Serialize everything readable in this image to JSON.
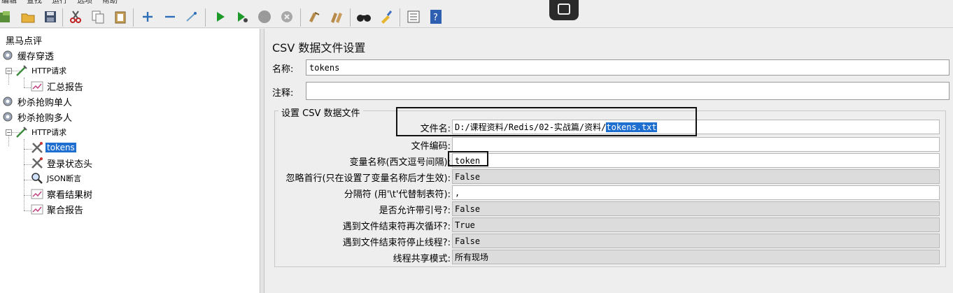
{
  "menu": [
    "编辑",
    "查找",
    "运行",
    "选项",
    "帮助"
  ],
  "toolbar_icons": [
    "new-icon",
    "open-icon",
    "save-icon",
    "cut-icon",
    "copy-icon",
    "paste-icon",
    "add-icon",
    "remove-icon",
    "toggle-icon",
    "start-icon",
    "start-no-pause-icon",
    "stop-icon",
    "shutdown-icon",
    "clear-icon",
    "clear-all-icon",
    "search-icon",
    "reset-icon",
    "function-helper-icon",
    "help-icon"
  ],
  "tree": {
    "root": "黑马点评",
    "items": [
      {
        "label": "缓存穿透",
        "icon": "gear-icon"
      },
      {
        "label": "HTTP请求",
        "icon": "pipette-icon"
      },
      {
        "label": "汇总报告",
        "icon": "chart-icon"
      },
      {
        "label": "秒杀抢购单人",
        "icon": "gear-icon"
      },
      {
        "label": "秒杀抢购多人",
        "icon": "gear-icon"
      },
      {
        "label": "HTTP请求",
        "icon": "pipette-icon"
      },
      {
        "label": "tokens",
        "icon": "wrench-icon"
      },
      {
        "label": "登录状态头",
        "icon": "wrench-icon"
      },
      {
        "label": "JSON断言",
        "icon": "magnifier-icon"
      },
      {
        "label": "察看结果树",
        "icon": "chart-icon"
      },
      {
        "label": "聚合报告",
        "icon": "chart-icon"
      }
    ]
  },
  "panel": {
    "title": "CSV 数据文件设置",
    "name_label": "名称:",
    "name_value": "tokens",
    "comment_label": "注释:",
    "comment_value": "",
    "group_title": "设置 CSV 数据文件",
    "rows": [
      {
        "label": "文件名:",
        "value_prefix": "D:/课程资料/Redis/02-实战篇/资料/",
        "value_selected": "tokens.txt"
      },
      {
        "label": "文件编码:",
        "value": ""
      },
      {
        "label": "变量名称(西文逗号间隔):",
        "value": "token"
      },
      {
        "label": "忽略首行(只在设置了变量名称后才生效):",
        "value": "False"
      },
      {
        "label": "分隔符 (用'\\t'代替制表符):",
        "value": ","
      },
      {
        "label": "是否允许带引号?:",
        "value": "False"
      },
      {
        "label": "遇到文件结束符再次循环?:",
        "value": "True"
      },
      {
        "label": "遇到文件结束符停止线程?:",
        "value": "False"
      },
      {
        "label": "线程共享模式:",
        "value": "所有现场"
      }
    ]
  },
  "colors": {
    "selection": "#1f6fd1",
    "background": "#eeeeee"
  }
}
